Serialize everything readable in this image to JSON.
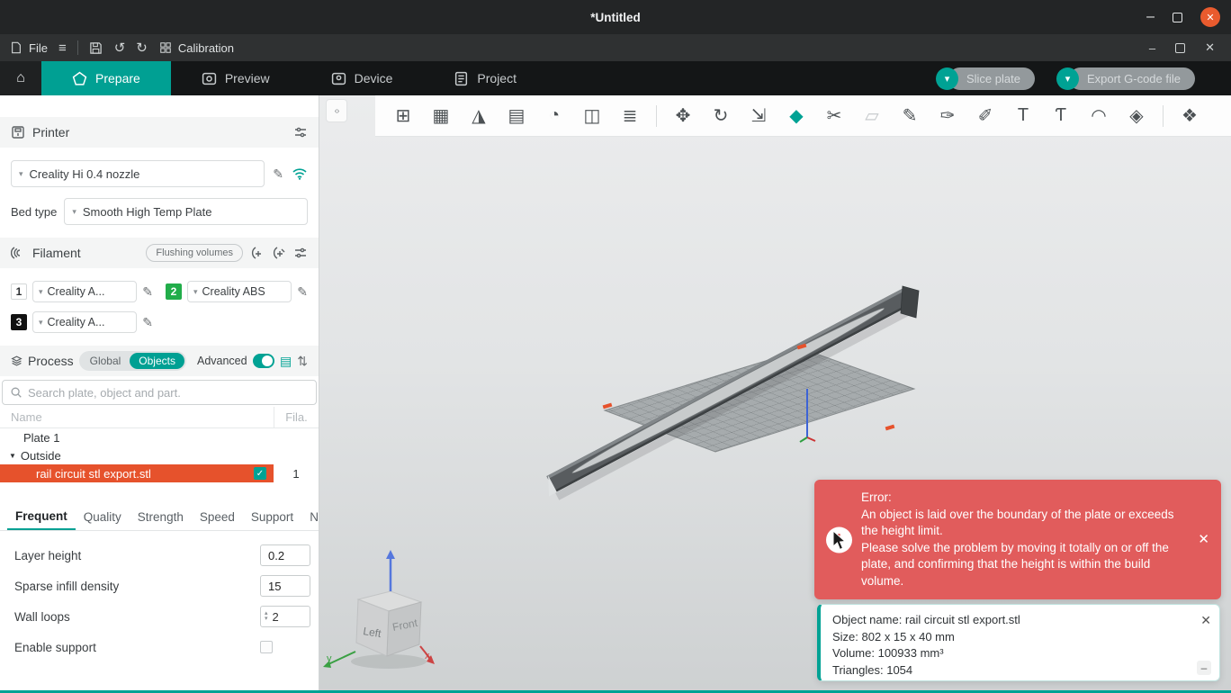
{
  "window": {
    "title": "*Untitled"
  },
  "ui": {
    "home": "⌂",
    "caret": "▾",
    "pencil": "✎",
    "hamburger": "≡",
    "undo": "↺",
    "redo": "↻",
    "minimize": "–",
    "close": "✕",
    "check": "✓",
    "tree_arrow": "▼",
    "collapse": "‹›",
    "spin_up": "▴",
    "spin_down": "▾"
  },
  "menubar": {
    "file": "File",
    "calibration": "Calibration"
  },
  "tabs": {
    "items": [
      {
        "label": "Prepare"
      },
      {
        "label": "Preview"
      },
      {
        "label": "Device"
      },
      {
        "label": "Project"
      }
    ],
    "slice": "Slice plate",
    "export": "Export G-code file"
  },
  "printer": {
    "title": "Printer",
    "name": "Creality Hi 0.4 nozzle",
    "bed_label": "Bed type",
    "bed_value": "Smooth High Temp Plate"
  },
  "filament": {
    "title": "Filament",
    "flushing": "Flushing volumes",
    "slots": [
      {
        "num": "1",
        "name": "Creality A...",
        "color": "#f2f2f2"
      },
      {
        "num": "2",
        "name": "Creality ABS",
        "color": "#22ad4a"
      },
      {
        "num": "3",
        "name": "Creality A...",
        "color": "#000000"
      }
    ]
  },
  "process": {
    "title": "Process",
    "global": "Global",
    "objects": "Objects",
    "advanced": "Advanced"
  },
  "search": {
    "placeholder": "Search plate, object and part."
  },
  "tree": {
    "name_col": "Name",
    "fila_col": "Fila.",
    "plate": "Plate 1",
    "group": "Outside",
    "object": "rail circuit stl export.stl",
    "object_fila": "1"
  },
  "param_tabs": {
    "items": [
      "Frequent",
      "Quality",
      "Strength",
      "Speed",
      "Support",
      "N"
    ]
  },
  "params": {
    "rows": [
      {
        "label": "Layer height",
        "value": "0.2"
      },
      {
        "label": "Sparse infill density",
        "value": "15"
      },
      {
        "label": "Wall loops",
        "value": "2"
      },
      {
        "label": "Enable support",
        "value": ""
      }
    ]
  },
  "toolbar": {
    "icons": [
      {
        "name": "add-model",
        "glyph": "⊞"
      },
      {
        "name": "arrange-all",
        "glyph": "▦"
      },
      {
        "name": "auto-orient",
        "glyph": "◮"
      },
      {
        "name": "fill-bed",
        "glyph": "▤"
      },
      {
        "name": "split-to-objects",
        "glyph": "◔"
      },
      {
        "name": "split-to-parts",
        "glyph": "◫"
      },
      {
        "name": "variable-layer-height",
        "glyph": "≣"
      },
      {
        "name": "move",
        "glyph": "✥"
      },
      {
        "name": "rotate",
        "glyph": "↻"
      },
      {
        "name": "scale",
        "glyph": "⇲"
      },
      {
        "name": "lay-on-face",
        "glyph": "◆"
      },
      {
        "name": "cut",
        "glyph": "✂"
      },
      {
        "name": "mesh-boolean",
        "glyph": "▱"
      },
      {
        "name": "support-painting",
        "glyph": "✎"
      },
      {
        "name": "seam-painting",
        "glyph": "✑"
      },
      {
        "name": "sketch",
        "glyph": "✐"
      },
      {
        "name": "text",
        "glyph": "T"
      },
      {
        "name": "text-shape",
        "glyph": "Ƭ"
      },
      {
        "name": "emboss",
        "glyph": "◠"
      },
      {
        "name": "measure",
        "glyph": "◈"
      },
      {
        "name": "assembly-view",
        "glyph": "❖"
      }
    ]
  },
  "viewport": {
    "error": {
      "title": "Error:",
      "body1": "An object is laid over the boundary of the plate or exceeds the height limit.",
      "body2": "Please solve the problem by moving it totally on or off the plate, and confirming that the height is within the build volume."
    },
    "info": {
      "line1": "Object name: rail circuit stl export.stl",
      "line2": "Size: 802 x 15 x 40 mm",
      "line3": "Volume: 100933 mm³",
      "line4": "Triangles: 1054"
    },
    "cube": {
      "left": "Left",
      "front": "Front",
      "x": "x",
      "y": "y"
    }
  },
  "colors": {
    "accent": "#00a294",
    "selection": "#e6522c",
    "error_bg": "#e15c5c",
    "active_tab": "#00a093"
  }
}
